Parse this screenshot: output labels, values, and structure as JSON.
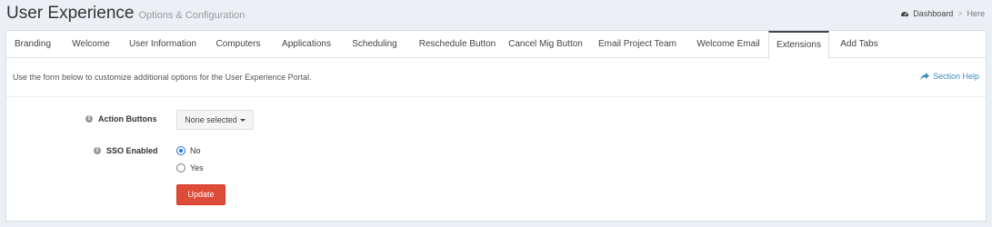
{
  "header": {
    "title": "User Experience",
    "subtitle": "Options & Configuration"
  },
  "breadcrumb": {
    "items": [
      "Dashboard",
      "Here"
    ],
    "separator": ">"
  },
  "tabs": [
    {
      "label": "Branding"
    },
    {
      "label": "Welcome"
    },
    {
      "label": "User Information"
    },
    {
      "label": "Computers"
    },
    {
      "label": "Applications"
    },
    {
      "label": "Scheduling"
    },
    {
      "label": "Reschedule Button"
    },
    {
      "label": "Cancel Mig Button"
    },
    {
      "label": "Email Project Team"
    },
    {
      "label": "Welcome Email"
    },
    {
      "label": "Extensions"
    },
    {
      "label": "Add Tabs"
    }
  ],
  "active_tab": "Extensions",
  "intro": {
    "text": "Use the form below to customize additional options for the User Experience Portal.",
    "help_label": "Section Help"
  },
  "form": {
    "action_buttons": {
      "label": "Action Buttons",
      "value": "None selected"
    },
    "sso_enabled": {
      "label": "SSO Enabled",
      "options": [
        "No",
        "Yes"
      ],
      "selected": "No"
    },
    "submit_label": "Update"
  },
  "colors": {
    "background": "#ecf0f5",
    "link": "#3c8dbc",
    "danger_button": "#dd4b39",
    "radio_checked": "#1a73e8"
  }
}
